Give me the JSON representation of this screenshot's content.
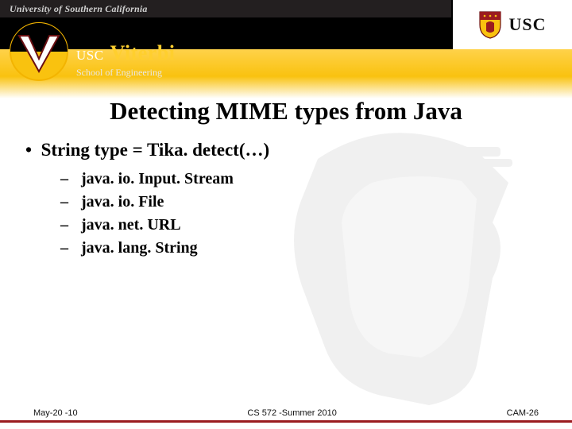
{
  "topbar": {
    "university": "University of Southern California"
  },
  "uscblock": {
    "word": "USC"
  },
  "lockup": {
    "usc": "USC",
    "viterbi": "Viterbi",
    "soe": "School of Engineering"
  },
  "title": "Detecting MIME types from Java",
  "bullet": "String type = Tika. detect(…)",
  "subitems": {
    "0": "java. io. Input. Stream",
    "1": "java. io. File",
    "2": "java. net. URL",
    "3": "java. lang. String"
  },
  "footer": {
    "left": "May-20 -10",
    "center": "CS 572 -Summer 2010",
    "right": "CAM-26"
  },
  "colors": {
    "gold": "#f9c20f",
    "cardinal": "#9b1b1f"
  }
}
